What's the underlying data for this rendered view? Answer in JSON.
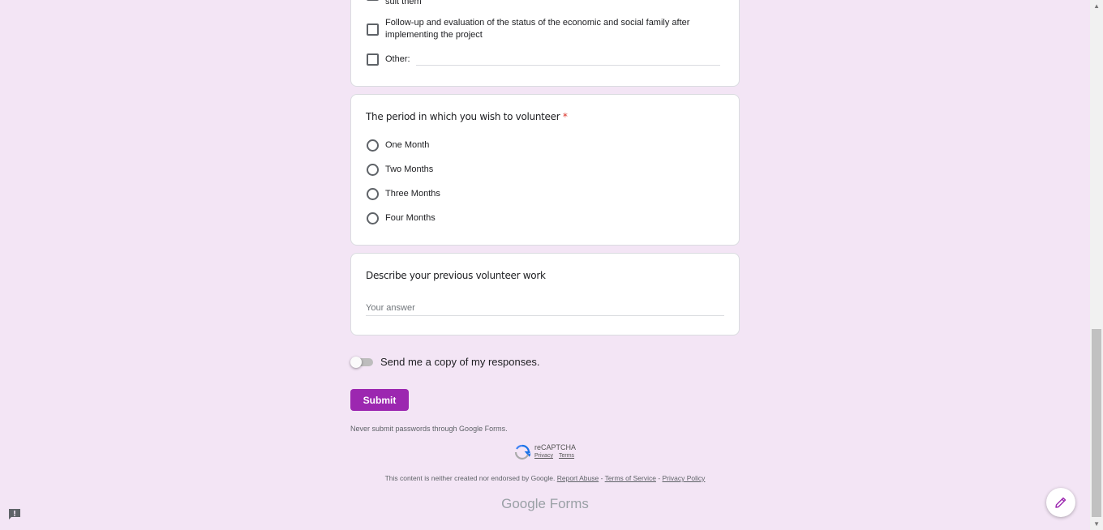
{
  "checkbox_question": {
    "partial_option": "suit them",
    "options": [
      {
        "label_line1": "Follow-up and evaluation of the status of the economic and social family after",
        "label_line2": "implementing the project"
      },
      {
        "label": "Other:"
      }
    ]
  },
  "period_question": {
    "title": "The period in which you wish to volunteer",
    "required_mark": "*",
    "options": [
      "One Month",
      "Two Months",
      "Three Months",
      "Four Months"
    ]
  },
  "previous_work_question": {
    "title": "Describe your previous volunteer work",
    "placeholder": "Your answer"
  },
  "send_copy": {
    "label": "Send me a copy of my responses."
  },
  "submit": {
    "label": "Submit"
  },
  "footer": {
    "password_warning": "Never submit passwords through Google Forms.",
    "recaptcha_label": "reCAPTCHA",
    "recaptcha_privacy": "Privacy",
    "recaptcha_terms": "Terms",
    "disclaimer": "This content is neither created nor endorsed by Google.",
    "report_abuse": "Report Abuse",
    "sep1": " - ",
    "terms_of_service": "Terms of Service",
    "sep2": " - ",
    "privacy_policy": "Privacy Policy",
    "logo_google": "Google",
    "logo_forms": "Forms"
  },
  "colors": {
    "background": "#f3e5f5",
    "accent": "#9c27b0",
    "required": "#d93025"
  },
  "icons": [
    "edit-pencil-icon",
    "report-problem-icon",
    "recaptcha-icon"
  ]
}
